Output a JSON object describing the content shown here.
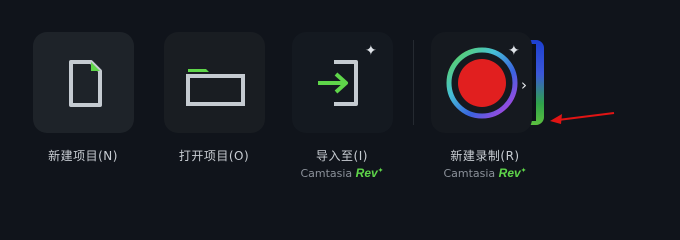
{
  "actions": [
    {
      "label": "新建项目(N)",
      "icon": "new-file-icon"
    },
    {
      "label": "打开项目(O)",
      "icon": "folder-icon"
    },
    {
      "label": "导入至(I)",
      "icon": "import-icon",
      "brand": "Camtasia",
      "brand_suffix": "Rev"
    },
    {
      "label": "新建录制(R)",
      "icon": "record-icon",
      "brand": "Camtasia",
      "brand_suffix": "Rev"
    }
  ],
  "colors": {
    "accent_green": "#5fd64a",
    "record_red": "#e11f1f",
    "annotation_arrow": "#e11414"
  }
}
